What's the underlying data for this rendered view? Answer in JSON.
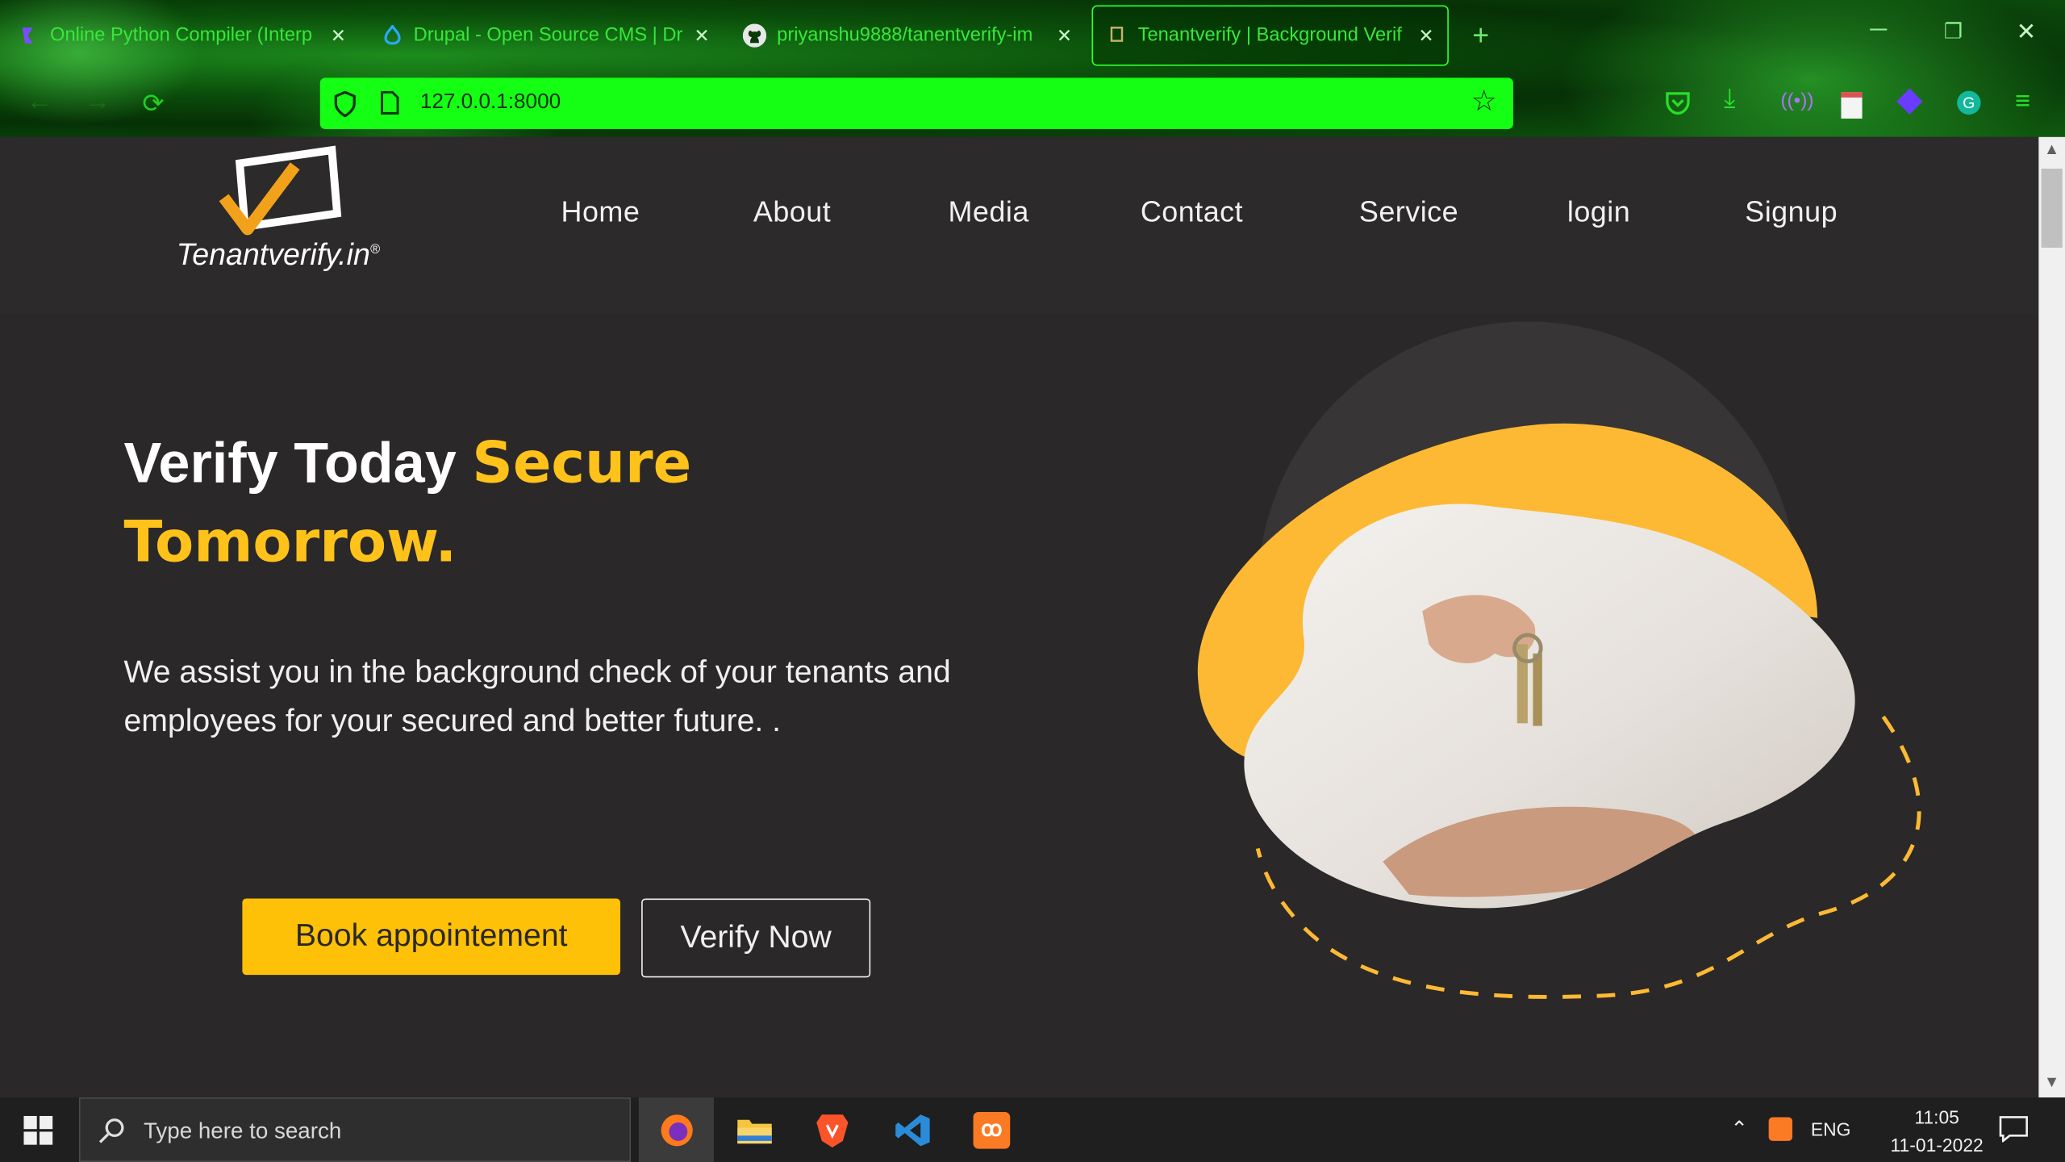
{
  "browser": {
    "tabs": [
      {
        "label": "Online Python Compiler (Interp",
        "icon": "python-compiler-icon"
      },
      {
        "label": "Drupal - Open Source CMS | Dr",
        "icon": "drupal-icon"
      },
      {
        "label": "priyanshu9888/tanentverify-im",
        "icon": "github-icon"
      },
      {
        "label": "Tenantverify | Background Verif",
        "icon": "tenantverify-icon"
      }
    ],
    "url": "127.0.0.1:8000"
  },
  "site": {
    "logo_text": "Tenantverify.in",
    "logo_mark": "®",
    "nav": [
      "Home",
      "About",
      "Media",
      "Contact",
      "Service",
      "login",
      "Signup"
    ],
    "hero": {
      "title_plain": "Verify Today ",
      "title_accent_1": "Secure",
      "title_accent_2": "Tomorrow.",
      "description": "We assist you in the background check of your tenants and employees for your secured and better future. .",
      "book_label": "Book appointement",
      "verify_label": "Verify Now"
    },
    "colors": {
      "accent": "#ffc107",
      "bg": "#2a2828"
    }
  },
  "taskbar": {
    "search_placeholder": "Type here to search",
    "lang": "ENG",
    "time": "11:05",
    "date": "11-01-2022"
  }
}
